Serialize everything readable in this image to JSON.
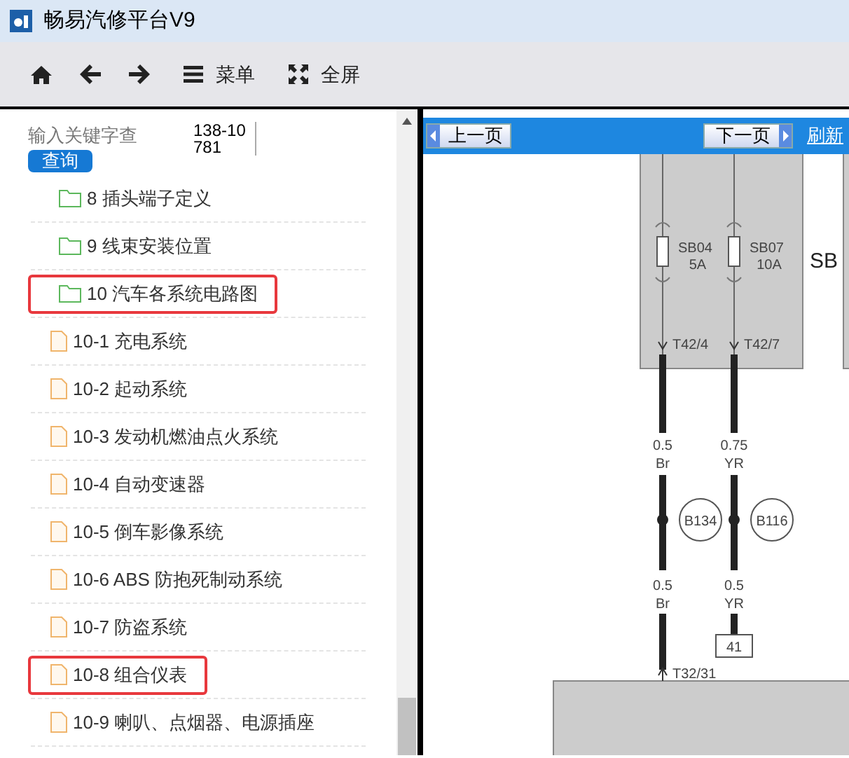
{
  "window": {
    "title": "畅易汽修平台V9"
  },
  "toolbar": [
    {
      "kind": "home"
    },
    {
      "kind": "back"
    },
    {
      "kind": "forward"
    },
    {
      "kind": "menu",
      "label": "菜单"
    },
    {
      "kind": "fullscreen",
      "label": "全屏"
    }
  ],
  "search": {
    "placeholder": "输入关键字查",
    "button": "查询",
    "phone": "138-10781"
  },
  "tree": [
    {
      "kind": "folder",
      "label": "8 插头端子定义",
      "highlighted": false
    },
    {
      "kind": "folder",
      "label": "9 线束安装位置",
      "highlighted": false
    },
    {
      "kind": "folder",
      "label": "10 汽车各系统电路图",
      "highlighted": true
    },
    {
      "kind": "file",
      "label": "10-1 充电系统",
      "highlighted": false
    },
    {
      "kind": "file",
      "label": "10-2 起动系统",
      "highlighted": false
    },
    {
      "kind": "file",
      "label": "10-3 发动机燃油点火系统",
      "highlighted": false
    },
    {
      "kind": "file",
      "label": "10-4 自动变速器",
      "highlighted": false
    },
    {
      "kind": "file",
      "label": "10-5 倒车影像系统",
      "highlighted": false
    },
    {
      "kind": "file",
      "label": "10-6 ABS 防抱死制动系统",
      "highlighted": false
    },
    {
      "kind": "file",
      "label": "10-7 防盗系统",
      "highlighted": false
    },
    {
      "kind": "file",
      "label": "10-8 组合仪表",
      "highlighted": true
    },
    {
      "kind": "file",
      "label": "10-9 喇叭、点烟器、电源插座",
      "highlighted": false
    }
  ],
  "pager": {
    "prev": "上一页",
    "next": "下一页",
    "refresh": "刷新"
  },
  "diagram": {
    "block_label": "SB",
    "fuses": [
      {
        "name": "SB04",
        "rating": "5A"
      },
      {
        "name": "SB07",
        "rating": "10A"
      }
    ],
    "connectors": [
      "T42/4",
      "T42/7"
    ],
    "wires_upper": [
      {
        "size": "0.5",
        "color_code": "Br"
      },
      {
        "size": "0.75",
        "color_code": "YR"
      }
    ],
    "splices": [
      "B134",
      "B116"
    ],
    "wires_lower": [
      {
        "size": "0.5",
        "color_code": "Br"
      },
      {
        "size": "0.5",
        "color_code": "YR"
      }
    ],
    "terminal": "41",
    "bottom_connector": "T32/31"
  }
}
